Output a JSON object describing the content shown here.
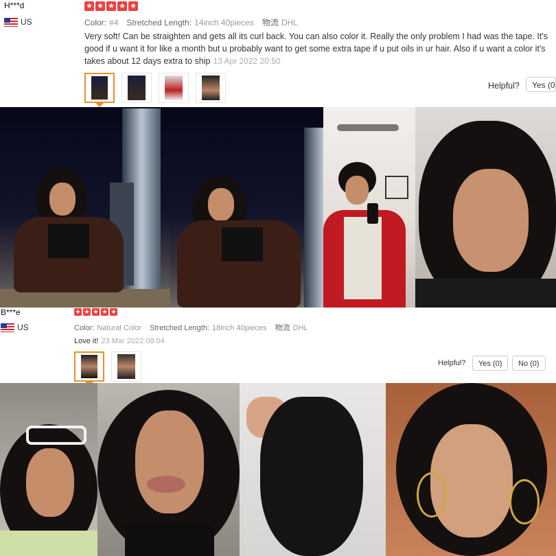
{
  "reviews": [
    {
      "user": "H***d",
      "country": "US",
      "rating": 5,
      "color_label": "Color:",
      "color_value": "#4",
      "length_label": "Stretched Length:",
      "length_value": "14inch 40pieces",
      "ship_label": "物流",
      "ship_value": "DHL",
      "text": "Very soft! Can be straighten and gets all its curl back. You can also color it. Really the only problem I had was the tape. It's good if u want it for like a month but u probably want to get some extra tape if u put oils in ur hair. Also if u want a color it's takes about 12 days extra to ship",
      "date": "13 Apr 2022 20:50",
      "helpful_label": "Helpful?",
      "yes_label": "Yes (0",
      "thumb_count": 4
    },
    {
      "user": "B***e",
      "country": "US",
      "rating": 5,
      "color_label": "Color:",
      "color_value": "Natural Color",
      "length_label": "Stretched Length:",
      "length_value": "18inch 40pieces",
      "ship_label": "物流",
      "ship_value": "DHL",
      "text": "Love it!",
      "date": "23 Mar 2022 08:04",
      "helpful_label": "Helpful?",
      "yes_label": "Yes (0)",
      "no_label": "No (0)",
      "thumb_count": 2
    }
  ],
  "colors": {
    "star": "#ee3f3f",
    "thumb_selected": "#e8912a",
    "meta_gray": "#999999"
  }
}
